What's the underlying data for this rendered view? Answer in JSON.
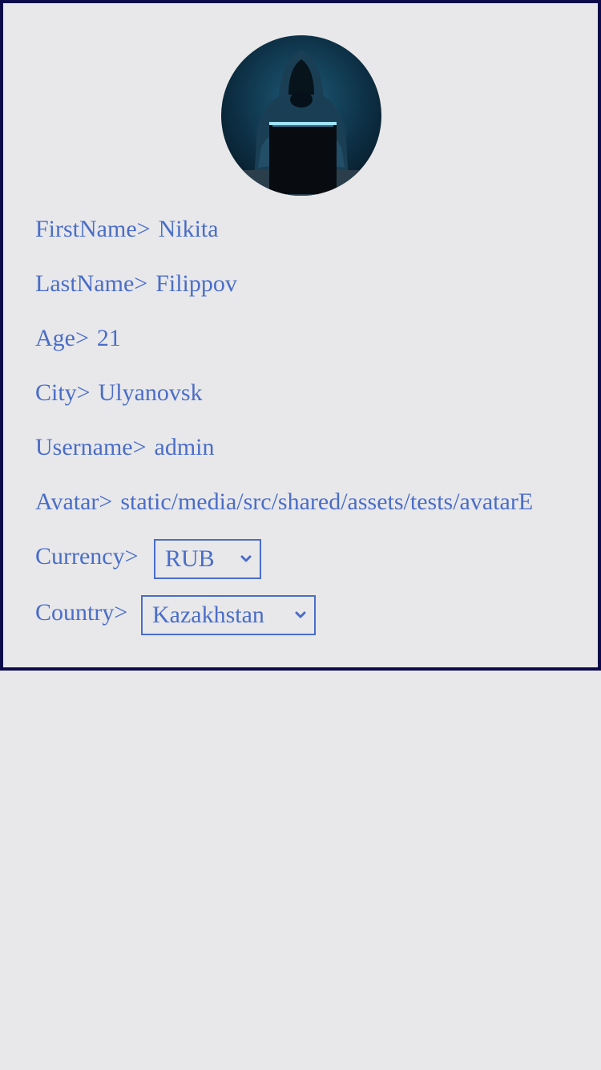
{
  "profile": {
    "avatar_icon": "hooded-hacker-avatar",
    "fields": {
      "firstname": {
        "label": "FirstName>",
        "value": "Nikita"
      },
      "lastname": {
        "label": "LastName>",
        "value": "Filippov"
      },
      "age": {
        "label": "Age>",
        "value": "21"
      },
      "city": {
        "label": "City>",
        "value": "Ulyanovsk"
      },
      "username": {
        "label": "Username>",
        "value": "admin"
      },
      "avatar": {
        "label": "Avatar>",
        "value": "static/media/src/shared/assets/tests/avatarE"
      }
    },
    "currency": {
      "label": "Currency>",
      "selected": "RUB"
    },
    "country": {
      "label": "Country>",
      "selected": "Kazakhstan"
    }
  },
  "colors": {
    "text": "#4a6dc8",
    "border": "#0c0a4a",
    "background": "#e8e8ea"
  }
}
